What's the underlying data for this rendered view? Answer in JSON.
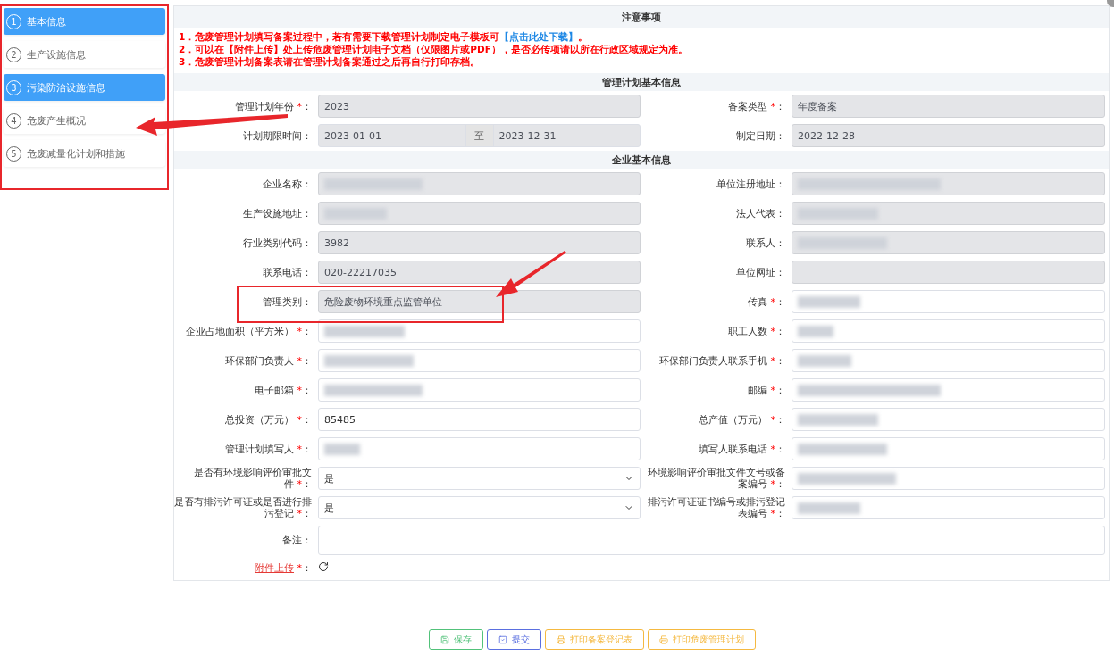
{
  "sidebar": {
    "annotated": true,
    "steps": [
      {
        "number": "1",
        "label": "基本信息",
        "selected": true
      },
      {
        "number": "2",
        "label": "生产设施信息",
        "selected": false
      },
      {
        "number": "3",
        "label": "污染防治设施信息",
        "selected": true
      },
      {
        "number": "4",
        "label": "危废产生概况",
        "selected": false
      },
      {
        "number": "5",
        "label": "危废减量化计划和措施",
        "selected": false
      }
    ]
  },
  "notice": {
    "title": "注意事项",
    "items": [
      {
        "text": "1．危废管理计划填写备案过程中，若有需要下载管理计划制定电子模板可",
        "link": "【点击此处下载】",
        "suffix": "。"
      },
      {
        "text": "2．可以在【附件上传】处上传危废管理计划电子文档（仅限图片或PDF），是否必传项请以所在行政区域规定为准。"
      },
      {
        "text": "3．危废管理计划备案表请在管理计划备案通过之后再自行打印存档。"
      }
    ]
  },
  "sections": [
    {
      "title": "管理计划基本信息",
      "fields": [
        {
          "kind": "text",
          "label": "管理计划年份",
          "mark": "*",
          "colon": "：",
          "value": "2023",
          "disabled": true
        },
        {
          "kind": "text",
          "label": "备案类型",
          "mark": "*",
          "colon": "：",
          "value": "年度备案",
          "disabled": true
        },
        {
          "kind": "daterange",
          "label": "计划期限时间",
          "colon": "：",
          "start": "2023-01-01",
          "separator": "至",
          "end": "2023-12-31",
          "disabled": true
        },
        {
          "kind": "text",
          "label": "制定日期",
          "colon": "：",
          "value": "2022-12-28",
          "disabled": true
        }
      ]
    },
    {
      "title": "企业基本信息",
      "fields": [
        {
          "kind": "text",
          "label": "企业名称",
          "colon": "：",
          "disabled": true,
          "blurred": true
        },
        {
          "kind": "text",
          "label": "单位注册地址",
          "colon": "：",
          "disabled": true,
          "blurred": true
        },
        {
          "kind": "text",
          "label": "生产设施地址",
          "colon": "：",
          "disabled": true,
          "blurred": true
        },
        {
          "kind": "text",
          "label": "法人代表",
          "colon": "：",
          "disabled": true,
          "blurred": true
        },
        {
          "kind": "text",
          "label": "行业类别代码",
          "colon": "：",
          "value": "3982",
          "disabled": true
        },
        {
          "kind": "text",
          "label": "联系人",
          "colon": "：",
          "disabled": true,
          "blurred": true
        },
        {
          "kind": "text",
          "label": "联系电话",
          "colon": "：",
          "value": "020-22217035",
          "disabled": true
        },
        {
          "kind": "text",
          "label": "单位网址",
          "colon": "：",
          "disabled": true
        },
        {
          "kind": "text",
          "label": "管理类别",
          "colon": "：",
          "value": "危险废物环境重点监管单位",
          "disabled": true,
          "annotated": true
        },
        {
          "kind": "text",
          "label": "传真",
          "mark": "*",
          "colon": "：",
          "disabled": false,
          "blurred": true
        },
        {
          "kind": "text",
          "label": "企业占地面积（平方米）",
          "mark": "*",
          "colon": "：",
          "disabled": false,
          "blurred": true
        },
        {
          "kind": "text",
          "label": "职工人数",
          "mark": "*",
          "colon": "：",
          "disabled": false,
          "blurred": true
        },
        {
          "kind": "text",
          "label": "环保部门负责人",
          "mark": "*",
          "colon": "：",
          "disabled": false,
          "blurred": true
        },
        {
          "kind": "text",
          "label": "环保部门负责人联系手机",
          "mark": "*",
          "colon": "：",
          "disabled": false,
          "blurred": true
        },
        {
          "kind": "text",
          "label": "电子邮箱",
          "mark": "*",
          "colon": "：",
          "disabled": false,
          "blurred": true
        },
        {
          "kind": "text",
          "label": "邮编",
          "mark": "*",
          "colon": "：",
          "disabled": false,
          "blurred": true
        },
        {
          "kind": "text",
          "label": "总投资（万元）",
          "mark": "*",
          "colon": "：",
          "value": "85485",
          "disabled": false
        },
        {
          "kind": "text",
          "label": "总产值（万元）",
          "mark": "*",
          "colon": "：",
          "disabled": false,
          "blurred": true
        },
        {
          "kind": "text",
          "label": "管理计划填写人",
          "mark": "*",
          "colon": "：",
          "disabled": false,
          "blurred": true
        },
        {
          "kind": "text",
          "label": "填写人联系电话",
          "mark": "*",
          "colon": "：",
          "disabled": false,
          "blurred": true
        },
        {
          "kind": "select",
          "label": "是否有环境影响评价审批文件",
          "mark": "*",
          "colon": "：",
          "value": "是",
          "disabled": false
        },
        {
          "kind": "text",
          "label": "环境影响评价审批文件文号或备案编号",
          "mark": "*",
          "colon": "：",
          "disabled": false,
          "blurred": true
        },
        {
          "kind": "select",
          "label": "是否有排污许可证或是否进行排污登记",
          "mark": "*",
          "colon": "：",
          "value": "是",
          "disabled": false
        },
        {
          "kind": "text",
          "label": "排污许可证证书编号或排污登记表编号",
          "mark": "*",
          "colon": "：",
          "disabled": false,
          "blurred": true
        },
        {
          "kind": "textarea",
          "label": "备注",
          "colon": "：",
          "disabled": false
        },
        {
          "kind": "upload",
          "label": "附件上传",
          "mark": "*",
          "colon": "："
        }
      ]
    }
  ],
  "buttons": [
    {
      "kind": "save",
      "label": "保存"
    },
    {
      "kind": "submit",
      "label": "提交"
    },
    {
      "kind": "print",
      "label": "打印备案登记表"
    },
    {
      "kind": "print",
      "label": "打印危废管理计划"
    }
  ]
}
